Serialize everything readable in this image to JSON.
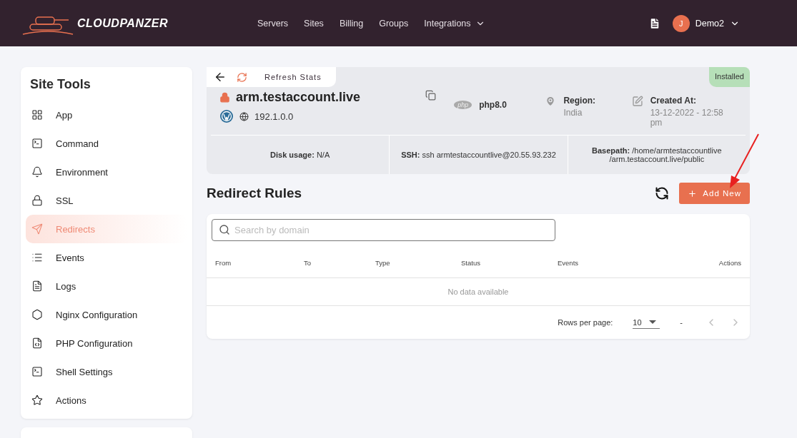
{
  "header": {
    "logo_text": "CLOUDPANZER",
    "nav": [
      {
        "label": "Servers",
        "dropdown": false
      },
      {
        "label": "Sites",
        "dropdown": false
      },
      {
        "label": "Billing",
        "dropdown": false
      },
      {
        "label": "Groups",
        "dropdown": false
      },
      {
        "label": "Integrations",
        "dropdown": true
      }
    ],
    "user": {
      "initial": "J",
      "name": "Demo2"
    }
  },
  "sidebar": {
    "title": "Site Tools",
    "items": [
      {
        "label": "App",
        "selected": false
      },
      {
        "label": "Command",
        "selected": false
      },
      {
        "label": "Environment",
        "selected": false
      },
      {
        "label": "SSL",
        "selected": false
      },
      {
        "label": "Redirects",
        "selected": true
      },
      {
        "label": "Events",
        "selected": false
      },
      {
        "label": "Logs",
        "selected": false
      },
      {
        "label": "Nginx Configuration",
        "selected": false
      },
      {
        "label": "PHP Configuration",
        "selected": false
      },
      {
        "label": "Shell Settings",
        "selected": false
      },
      {
        "label": "Actions",
        "selected": false
      }
    ]
  },
  "site": {
    "refresh_label": "Refresh Stats",
    "status": "Installed",
    "domain": "arm.testaccount.live",
    "ip": "192.1.0.0",
    "php_badge": "php",
    "php": "php8.0",
    "region_label": "Region:",
    "region": "India",
    "created_label": "Created At:",
    "created": "13-12-2022 - 12:58 pm",
    "stats": [
      "**Disk usage:** N/A",
      "**SSH:** ssh armtestaccountlive@20.55.93.232",
      "**Basepath:** /home/armtestaccountlive /arm.testaccount.live/public"
    ]
  },
  "redirects": {
    "title": "Redirect Rules",
    "add_button": "Add New",
    "search": {
      "placeholder": "Search by domain"
    },
    "columns": [
      "From",
      "To",
      "Type",
      "Status",
      "Events",
      "Actions"
    ],
    "empty": "No data available",
    "rows_per_page_label": "Rows per page:",
    "rows_per_page": "10",
    "range": "-"
  }
}
